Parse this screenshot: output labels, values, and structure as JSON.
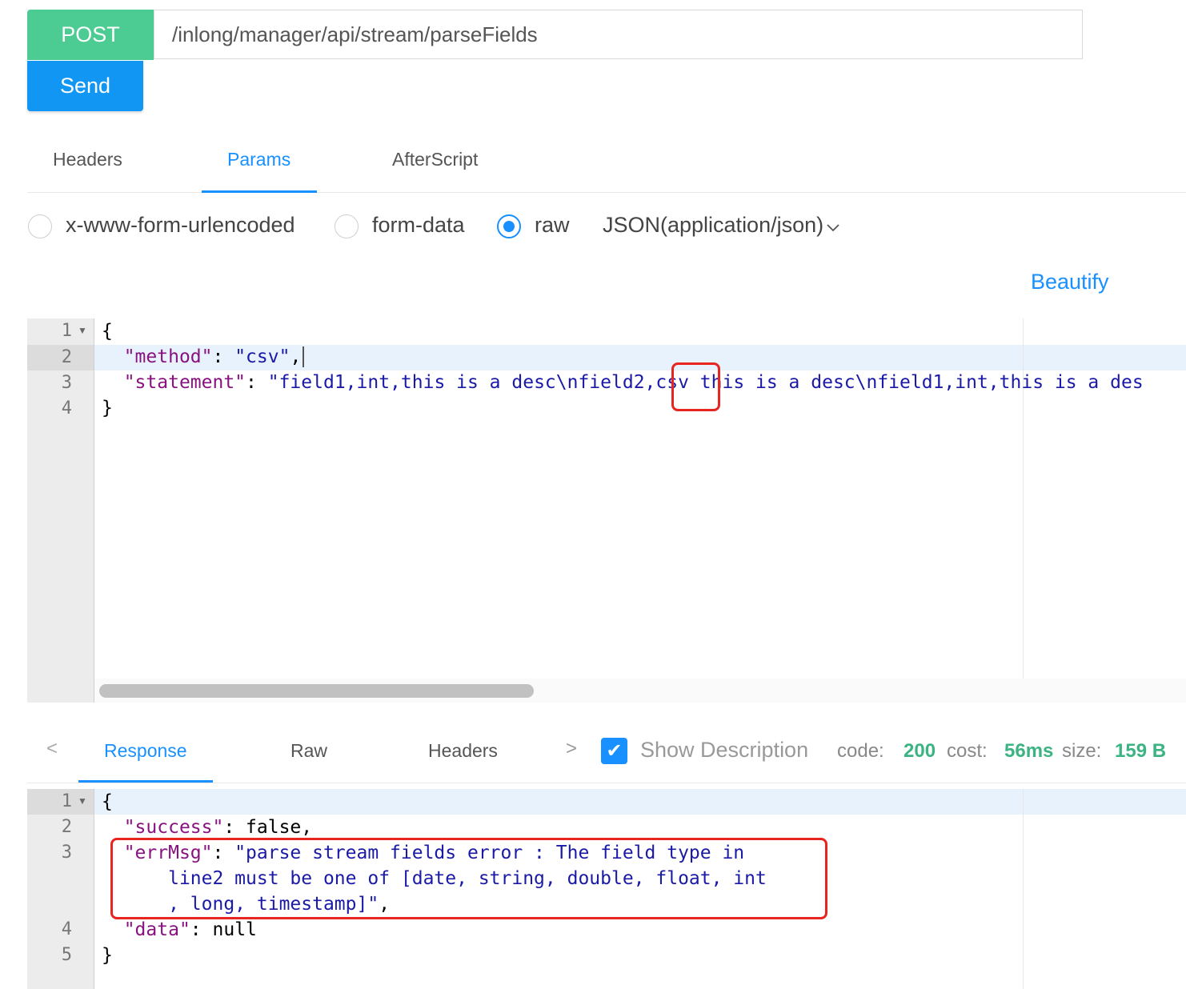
{
  "request": {
    "method": "POST",
    "url": "/inlong/manager/api/stream/parseFields",
    "send_label": "Send"
  },
  "request_tabs": [
    "Headers",
    "Params",
    "AfterScript"
  ],
  "body_types": [
    "x-www-form-urlencoded",
    "form-data",
    "raw"
  ],
  "content_type": "JSON(application/json)",
  "beautify_label": "Beautify",
  "request_body": {
    "line_numbers": [
      "1",
      "2",
      "3",
      "4"
    ],
    "open_brace": "{",
    "method_key": "\"method\"",
    "method_value": "\"csv\"",
    "statement_key": "\"statement\"",
    "statement_value_a": "\"field1,int,this is a desc\\nfield2,",
    "statement_value_hl": "csv",
    "statement_value_b": " this is a desc\\nfield1,int,this is a des",
    "close_brace": "}"
  },
  "response_tabs": [
    "Response",
    "Raw",
    "Headers"
  ],
  "show_description_label": "Show Description",
  "meta": {
    "code_label": "code:",
    "code_value": "200",
    "cost_label": "cost:",
    "cost_value": "56ms",
    "size_label": "size:",
    "size_value": "159 B"
  },
  "response_body": {
    "line_numbers": [
      "1",
      "2",
      "3",
      "4",
      "5"
    ],
    "open_brace": "{",
    "success_key": "\"success\"",
    "success_value": "false",
    "errmsg_key": "\"errMsg\"",
    "errmsg_line1": "\"parse stream fields error : The field type in",
    "errmsg_line2": "line2 must be one of [date, string, double, float, int",
    "errmsg_line3": ", long, timestamp]\"",
    "data_key": "\"data\"",
    "data_value": "null",
    "close_brace": "}"
  },
  "colors": {
    "method_green": "#4ccc92",
    "send_blue": "#1296f3",
    "accent_blue": "#1890ff",
    "highlight_red": "#e8251f",
    "meta_green": "#3cb383"
  }
}
